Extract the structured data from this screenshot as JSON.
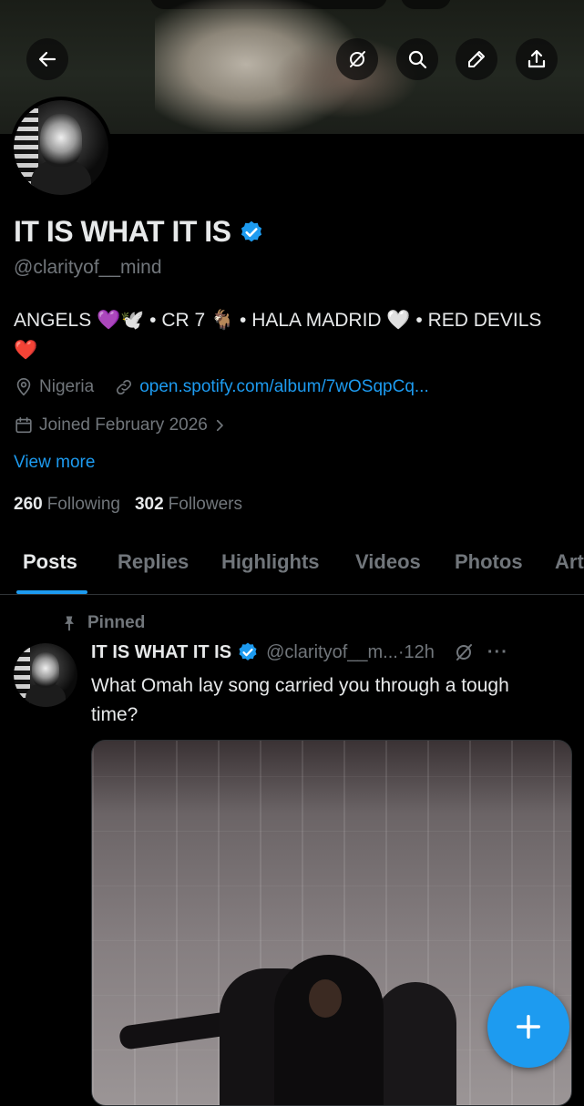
{
  "profile": {
    "name": "IT IS WHAT IT IS",
    "handle": "@clarityof__mind",
    "bio": "ANGELS 💜🕊️ • CR 7 🐐 • HALA MADRID 🤍 • RED DEVILS ❤️",
    "location": "Nigeria",
    "link": "open.spotify.com/album/7wOSqpCq...",
    "joined": "Joined February 2026",
    "view_more": "View more",
    "following_count": "260",
    "following_label": "Following",
    "followers_count": "302",
    "followers_label": "Followers"
  },
  "tabs": [
    {
      "label": "Posts"
    },
    {
      "label": "Replies"
    },
    {
      "label": "Highlights"
    },
    {
      "label": "Videos"
    },
    {
      "label": "Photos"
    },
    {
      "label": "Art"
    }
  ],
  "post": {
    "pinned_label": "Pinned",
    "author": "IT IS WHAT IT IS",
    "handle": "@clarityof__m...",
    "time": "·12h",
    "more": "···",
    "text": "What Omah lay song carried you through a tough time?"
  },
  "icons": {
    "back": "back-arrow-icon",
    "grok": "grok-icon",
    "search": "search-icon",
    "edit": "edit-pencil-icon",
    "share": "share-icon",
    "verified": "verified-badge-icon",
    "location": "location-pin-icon",
    "link": "link-icon",
    "calendar": "calendar-icon",
    "pin": "pin-icon",
    "compose": "plus-icon"
  },
  "colors": {
    "accent": "#1d9bf0",
    "muted": "#71767b",
    "text": "#e7e9ea",
    "background": "#000000"
  }
}
